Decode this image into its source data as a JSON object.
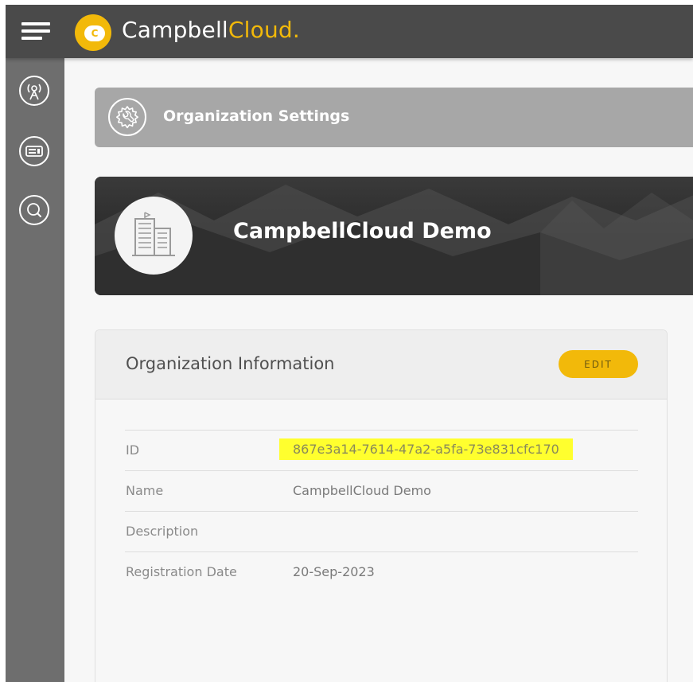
{
  "app": {
    "brand_primary": "Campbell",
    "brand_accent": "Cloud",
    "brand_dot": ".",
    "logo_letter": "C"
  },
  "colors": {
    "topbar": "#4a4a4a",
    "rail": "#6e6e6e",
    "accent": "#f2b90a",
    "highlight": "#ffff2e"
  },
  "nav": {
    "menu_icon": "hamburger-icon",
    "rail_items": [
      {
        "icon": "antenna-tower-icon"
      },
      {
        "icon": "datalogger-icon"
      },
      {
        "icon": "search-icon"
      }
    ]
  },
  "page": {
    "section_title": "Organization Settings",
    "section_icon": "gear-wrench-icon",
    "org_name": "CampbellCloud Demo",
    "org_icon": "building-icon"
  },
  "info_card": {
    "title": "Organization Information",
    "edit_label": "EDIT",
    "rows": [
      {
        "label": "ID",
        "value": "867e3a14-7614-47a2-a5fa-73e831cfc170"
      },
      {
        "label": "Name",
        "value": "CampbellCloud Demo"
      },
      {
        "label": "Description",
        "value": ""
      },
      {
        "label": "Registration Date",
        "value": "20-Sep-2023"
      }
    ]
  }
}
